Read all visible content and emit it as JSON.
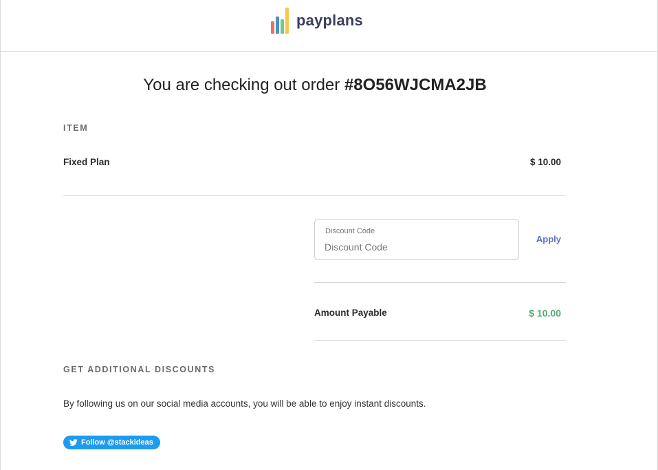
{
  "header": {
    "brand_name": "payplans",
    "logo_colors": [
      "#e8735a",
      "#4a90c8",
      "#7cc47f",
      "#f2c94c"
    ]
  },
  "checkout": {
    "title_prefix": "You are checking out order ",
    "order_id": "#8O56WJCMA2JB"
  },
  "items_section": {
    "label": "ITEM",
    "items": [
      {
        "name": "Fixed Plan",
        "price": "$ 10.00"
      }
    ]
  },
  "discount": {
    "field_label": "Discount Code",
    "placeholder": "Discount Code",
    "value": "",
    "apply_label": "Apply"
  },
  "total": {
    "label": "Amount Payable",
    "value": "$ 10.00",
    "value_color": "#4caf6a"
  },
  "additional_discounts": {
    "label": "GET ADDITIONAL DISCOUNTS",
    "description": "By following us on our social media accounts, you will be able to enjoy instant discounts.",
    "twitter_button_label": "Follow @stackideas",
    "twitter_icon": "twitter-bird-icon",
    "twitter_color": "#1d9bf0"
  }
}
